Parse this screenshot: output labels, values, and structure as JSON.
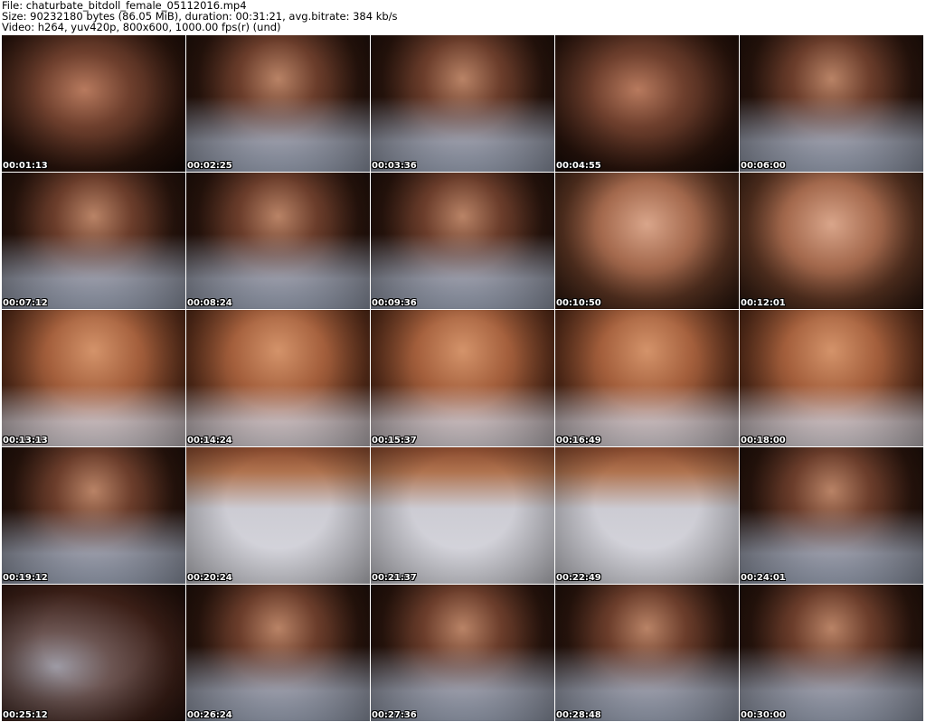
{
  "header": {
    "line1": "File: chaturbate_bitdoll_female_05112016.mp4",
    "line2": "Size: 90232180 bytes (86.05 MiB), duration: 00:31:21, avg.bitrate: 384 kb/s",
    "line3": "Video: h264, yuv420p, 800x600, 1000.00 fps(r) (und)"
  },
  "thumbnails": [
    {
      "timestamp": "00:01:13",
      "tone": "warm-dark"
    },
    {
      "timestamp": "00:02:25",
      "tone": "grey-hoodie"
    },
    {
      "timestamp": "00:03:36",
      "tone": "grey-hoodie"
    },
    {
      "timestamp": "00:04:55",
      "tone": "warm-dark"
    },
    {
      "timestamp": "00:06:00",
      "tone": "grey-hoodie"
    },
    {
      "timestamp": "00:07:12",
      "tone": "grey-hoodie"
    },
    {
      "timestamp": "00:08:24",
      "tone": "grey-hoodie"
    },
    {
      "timestamp": "00:09:36",
      "tone": "grey-hoodie"
    },
    {
      "timestamp": "00:10:50",
      "tone": "close-face"
    },
    {
      "timestamp": "00:12:01",
      "tone": "close-face"
    },
    {
      "timestamp": "00:13:13",
      "tone": "close-warm"
    },
    {
      "timestamp": "00:14:24",
      "tone": "close-warm"
    },
    {
      "timestamp": "00:15:37",
      "tone": "close-warm"
    },
    {
      "timestamp": "00:16:49",
      "tone": "close-warm"
    },
    {
      "timestamp": "00:18:00",
      "tone": "close-warm"
    },
    {
      "timestamp": "00:19:12",
      "tone": "grey-hoodie"
    },
    {
      "timestamp": "00:20:24",
      "tone": "hoodie-light"
    },
    {
      "timestamp": "00:21:37",
      "tone": "hoodie-light"
    },
    {
      "timestamp": "00:22:49",
      "tone": "hoodie-light"
    },
    {
      "timestamp": "00:24:01",
      "tone": "grey-hoodie"
    },
    {
      "timestamp": "00:25:12",
      "tone": "room"
    },
    {
      "timestamp": "00:26:24",
      "tone": "grey-hoodie"
    },
    {
      "timestamp": "00:27:36",
      "tone": "grey-hoodie"
    },
    {
      "timestamp": "00:28:48",
      "tone": "grey-hoodie"
    },
    {
      "timestamp": "00:30:00",
      "tone": "grey-hoodie"
    }
  ],
  "colors": {
    "background": "#ffffff",
    "text": "#000000",
    "timestamp": "#ffffff"
  }
}
